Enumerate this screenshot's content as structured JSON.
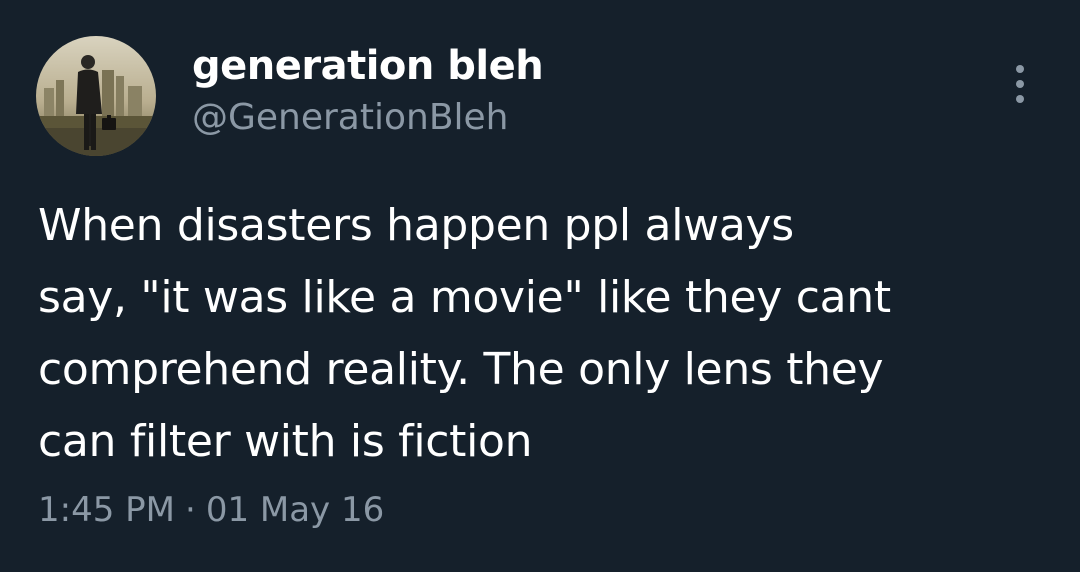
{
  "author": {
    "display_name": "generation bleh",
    "handle": "@GenerationBleh",
    "avatar_icon": "man-with-briefcase-avatar"
  },
  "menu": {
    "icon": "more-vertical-icon"
  },
  "tweet": {
    "text": "When disasters happen ppl always\nsay, \"it was like a movie\" like they cant\ncomprehend reality. The only lens they\ncan filter with is fiction"
  },
  "meta": {
    "time": "1:45 PM",
    "separator": "·",
    "date": "01 May 16"
  },
  "colors": {
    "background": "#15202b",
    "primary_text": "#ffffff",
    "secondary_text": "#8b98a5"
  }
}
